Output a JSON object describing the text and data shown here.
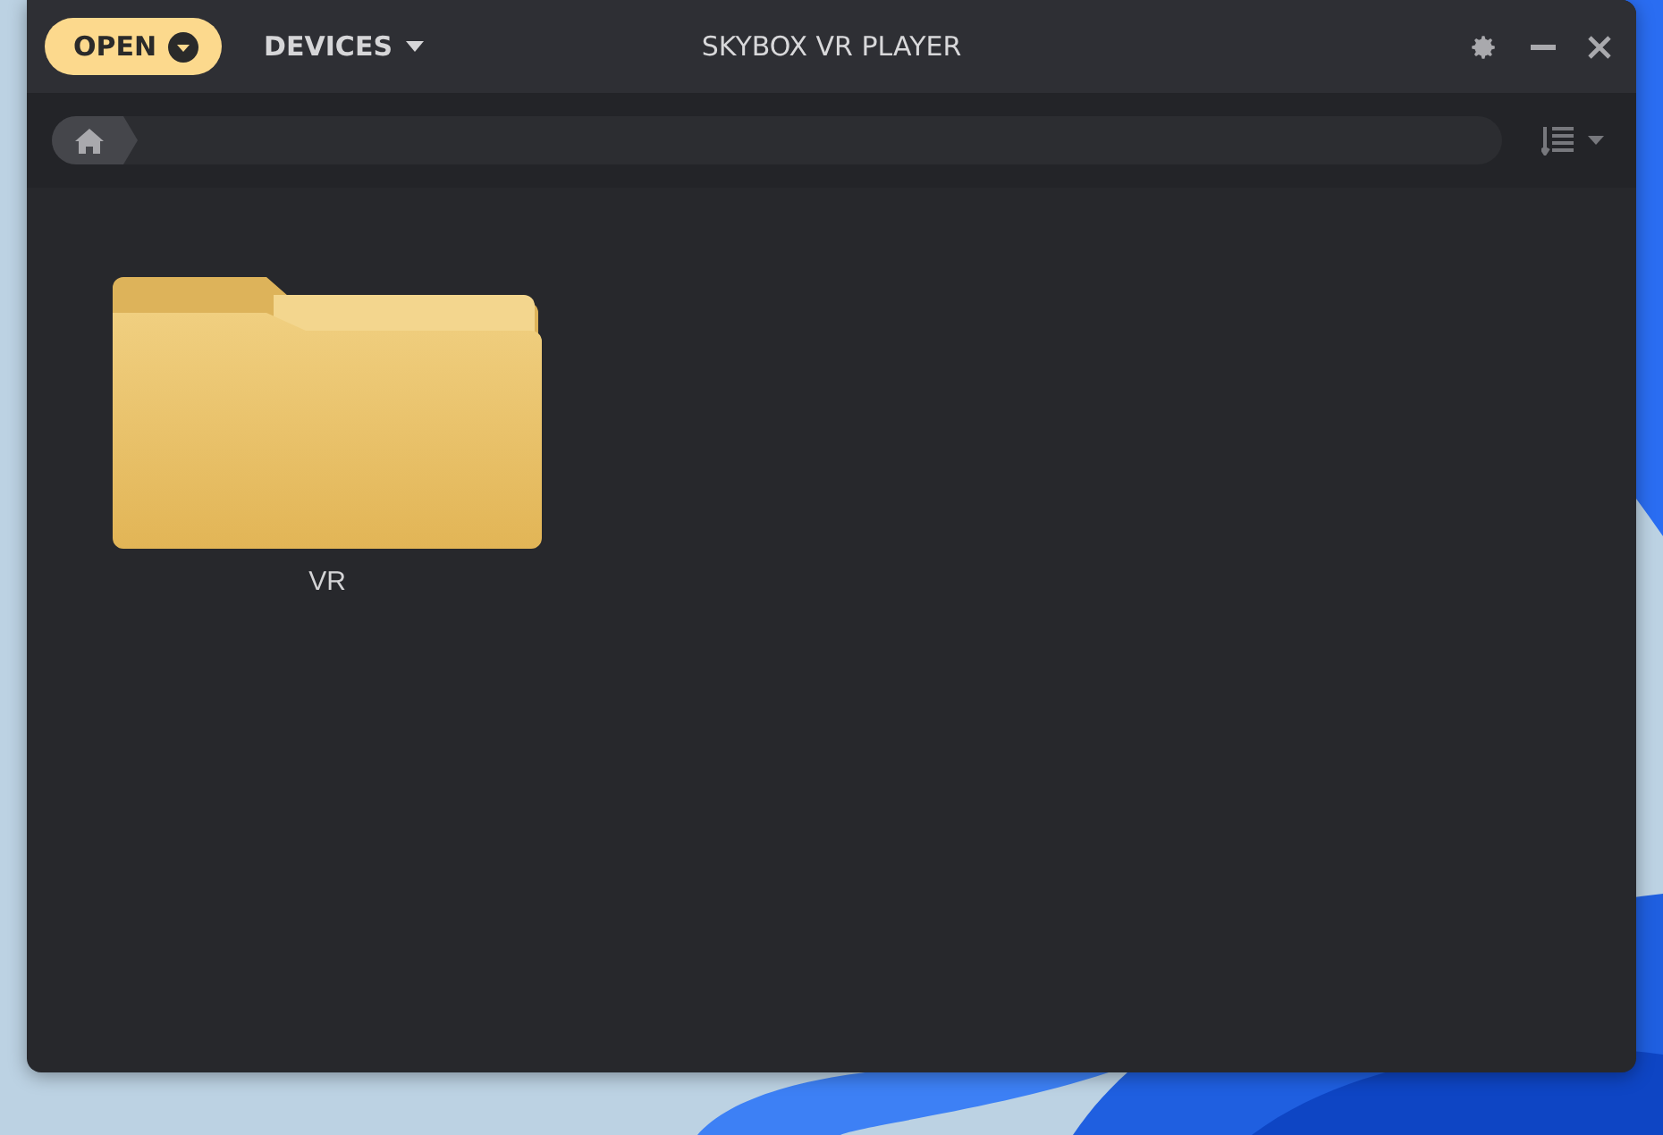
{
  "window": {
    "title": "SKYBOX VR PLAYER"
  },
  "header": {
    "open_button": "OPEN",
    "devices_menu": "DEVICES"
  },
  "files": [
    {
      "name": "VR",
      "kind": "folder"
    }
  ]
}
